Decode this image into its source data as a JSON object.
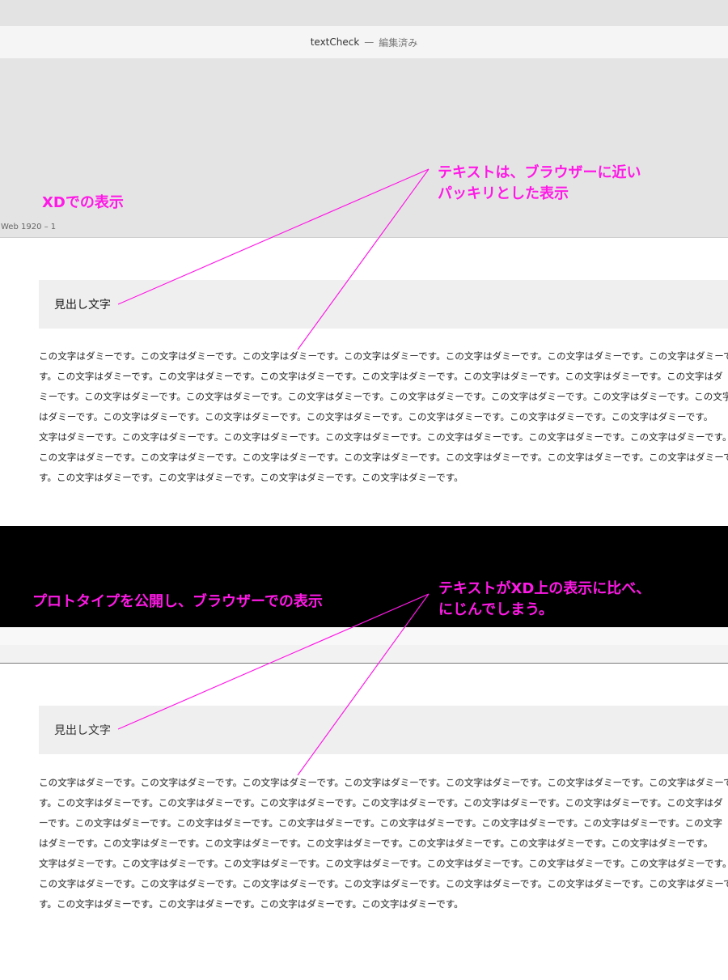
{
  "window": {
    "doc_name": "textCheck",
    "separator": "—",
    "status": "編集済み"
  },
  "artboard_label": "Web 1920 – 1",
  "annotations": {
    "xd_label": "XDでの表示",
    "xd_note": "テキストは、ブラウザーに近い\nパッキリとした表示",
    "browser_label": "プロトタイプを公開し、ブラウザーでの表示",
    "browser_note": "テキストがXD上の表示に比べ、\nにじんでしまう。",
    "color": "#ff19e6"
  },
  "xd_section": {
    "heading": "見出し文字",
    "lines": [
      "この文字はダミーです。この文字はダミーです。この文字はダミーです。この文字はダミーです。この文字はダミーです。この文字はダミーです。この文字はダミーで",
      "す。この文字はダミーです。この文字はダミーです。この文字はダミーです。この文字はダミーです。この文字はダミーです。この文字はダミーです。この文字はダ",
      "ミーです。この文字はダミーです。この文字はダミーです。この文字はダミーです。この文字はダミーです。この文字はダミーです。この文字はダミーです。この文字",
      "はダミーです。この文字はダミーです。この文字はダミーです。この文字はダミーです。この文字はダミーです。この文字はダミーです。この文字はダミーです。",
      "文字はダミーです。この文字はダミーです。この文字はダミーです。この文字はダミーです。この文字はダミーです。この文字はダミーです。この文字はダミーです。",
      "この文字はダミーです。この文字はダミーです。この文字はダミーです。この文字はダミーです。この文字はダミーです。この文字はダミーです。この文字はダミーで",
      "す。この文字はダミーです。この文字はダミーです。この文字はダミーです。この文字はダミーです。"
    ]
  },
  "browser_section": {
    "heading": "見出し文字",
    "lines": [
      "この文字はダミーです。この文字はダミーです。この文字はダミーです。この文字はダミーです。この文字はダミーです。この文字はダミーです。この文字はダミーで",
      "す。この文字はダミーです。この文字はダミーです。この文字はダミーです。この文字はダミーです。この文字はダミーです。この文字はダミーです。この文字はダ",
      "ーです。この文字はダミーです。この文字はダミーです。この文字はダミーです。この文字はダミーです。この文字はダミーです。この文字はダミーです。この文字",
      "はダミーです。この文字はダミーです。この文字はダミーです。この文字はダミーです。この文字はダミーです。この文字はダミーです。この文字はダミーです。",
      "文字はダミーです。この文字はダミーです。この文字はダミーです。この文字はダミーです。この文字はダミーです。この文字はダミーです。この文字はダミーです。",
      "この文字はダミーです。この文字はダミーです。この文字はダミーです。この文字はダミーです。この文字はダミーです。この文字はダミーです。この文字はダミーで",
      "す。この文字はダミーです。この文字はダミーです。この文字はダミーです。この文字はダミーです。"
    ]
  }
}
